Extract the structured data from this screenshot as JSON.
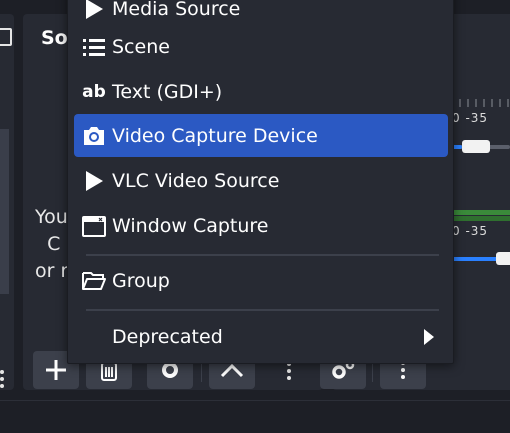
{
  "sources_dock": {
    "title_partial": "Sou",
    "hint_lines": "You\n  C\nor r"
  },
  "mixer": {
    "title_partial": "/",
    "scale_top": "0   -35",
    "scale_bottom": "0   -35"
  },
  "context_menu": {
    "items": [
      {
        "label": "Media Source",
        "icon": "play-icon"
      },
      {
        "label": "Scene",
        "icon": "list-icon"
      },
      {
        "label": "Text (GDI+)",
        "icon": "text-ab-icon"
      },
      {
        "label": "Video Capture Device",
        "icon": "camera-icon",
        "selected": true
      },
      {
        "label": "VLC Video Source",
        "icon": "play-icon"
      },
      {
        "label": "Window Capture",
        "icon": "window-icon"
      },
      {
        "label": "Group",
        "icon": "folder-open-icon"
      },
      {
        "label": "Deprecated",
        "icon": "",
        "submenu": true
      }
    ]
  },
  "colors": {
    "selection": "#2b59c3",
    "menu_bg": "#272a33",
    "window_bg": "#1d1f26",
    "button_bg": "#3c404b",
    "fader_blue": "#2a80ff"
  }
}
